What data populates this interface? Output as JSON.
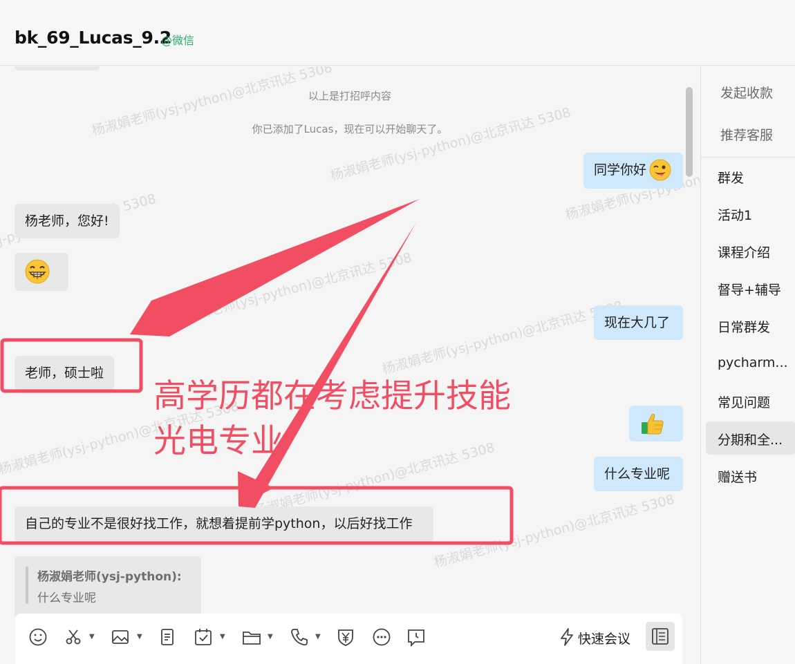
{
  "window": {
    "title": "bk_69_Lucas_9.2",
    "title_suffix": "@微信"
  },
  "chat": {
    "system_greeting": "以上是打招呼内容",
    "system_added": "你已添加了Lucas，现在可以开始聊天了。",
    "messages": [
      {
        "side": "right",
        "text": "同学你好"
      },
      {
        "side": "left",
        "text": "杨老师，您好!"
      },
      {
        "side": "left",
        "text": ""
      },
      {
        "side": "right",
        "text": "现在大几了"
      },
      {
        "side": "left",
        "text": "老师，硕士啦"
      },
      {
        "side": "right",
        "text": ""
      },
      {
        "side": "right",
        "text": "什么专业呢"
      },
      {
        "side": "left",
        "text": "自己的专业不是很好找工作，就想着提前学python，以后好找工作"
      }
    ],
    "quote": {
      "author": "杨淑娟老师(ysj-python):",
      "text": "什么专业呢"
    },
    "watermark": "杨淑娟老师(ysj-python)@北京讯达 5308"
  },
  "annotation": {
    "line1": "高学历都在考虑提升技能",
    "line2": "光电专业",
    "color": "#f24e63"
  },
  "sidebar": {
    "top_actions": [
      "发起收款",
      "推荐客服"
    ],
    "items": [
      "群发",
      "活动1",
      "课程介绍",
      "督导+辅导",
      "日常群发",
      "pycharm...",
      "常见问题",
      "分期和全...",
      "赠送书"
    ],
    "active_index": 7
  },
  "toolbar": {
    "icons": [
      "emoji-icon",
      "scissors-icon",
      "image-icon",
      "document-icon",
      "calendar-check-icon",
      "folder-icon",
      "phone-icon",
      "yuan-shield-icon",
      "more-icon",
      "chat-clock-icon"
    ],
    "quick_meeting_label": "快速会议"
  }
}
